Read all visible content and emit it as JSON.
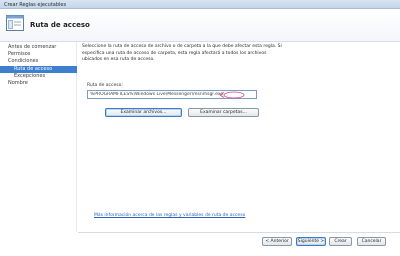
{
  "window": {
    "title": "Crear Reglas ejecutables"
  },
  "header": {
    "title": "Ruta de acceso",
    "icon": "wizard-window-icon"
  },
  "sidebar": {
    "items": [
      {
        "label": "Antes de comenzar",
        "sub": false,
        "selected": false
      },
      {
        "label": "Permisos",
        "sub": false,
        "selected": false
      },
      {
        "label": "Condiciones",
        "sub": false,
        "selected": false
      },
      {
        "label": "Ruta de acceso",
        "sub": true,
        "selected": true
      },
      {
        "label": "Excepciones",
        "sub": true,
        "selected": false
      },
      {
        "label": "Nombre",
        "sub": false,
        "selected": false
      }
    ]
  },
  "main": {
    "description": "Seleccione la ruta de acceso de archivo o de carpeta a la que debe afectar esta regla. Si especifica una ruta de acceso de carpeta, esta regla afectará a todos los archivos ubicados en esa ruta de acceso.",
    "path_label": "Ruta de acceso:",
    "path_value": "%PROGRAMFILES%\\Windows Live\\Messenger\\msnmsgr.exe",
    "browse_files_label": "Examinar archivos...",
    "browse_folders_label": "Examinar carpetas...",
    "help_link": "Más información acerca de las reglas y variables de ruta de acceso"
  },
  "footer": {
    "back_label": "< Anterior",
    "next_label": "Siguiente >",
    "create_label": "Crear",
    "cancel_label": "Cancelar"
  },
  "colors": {
    "selection": "#3f7fcf",
    "link": "#2a63b5",
    "annotation_arrow": "#d9477a"
  }
}
